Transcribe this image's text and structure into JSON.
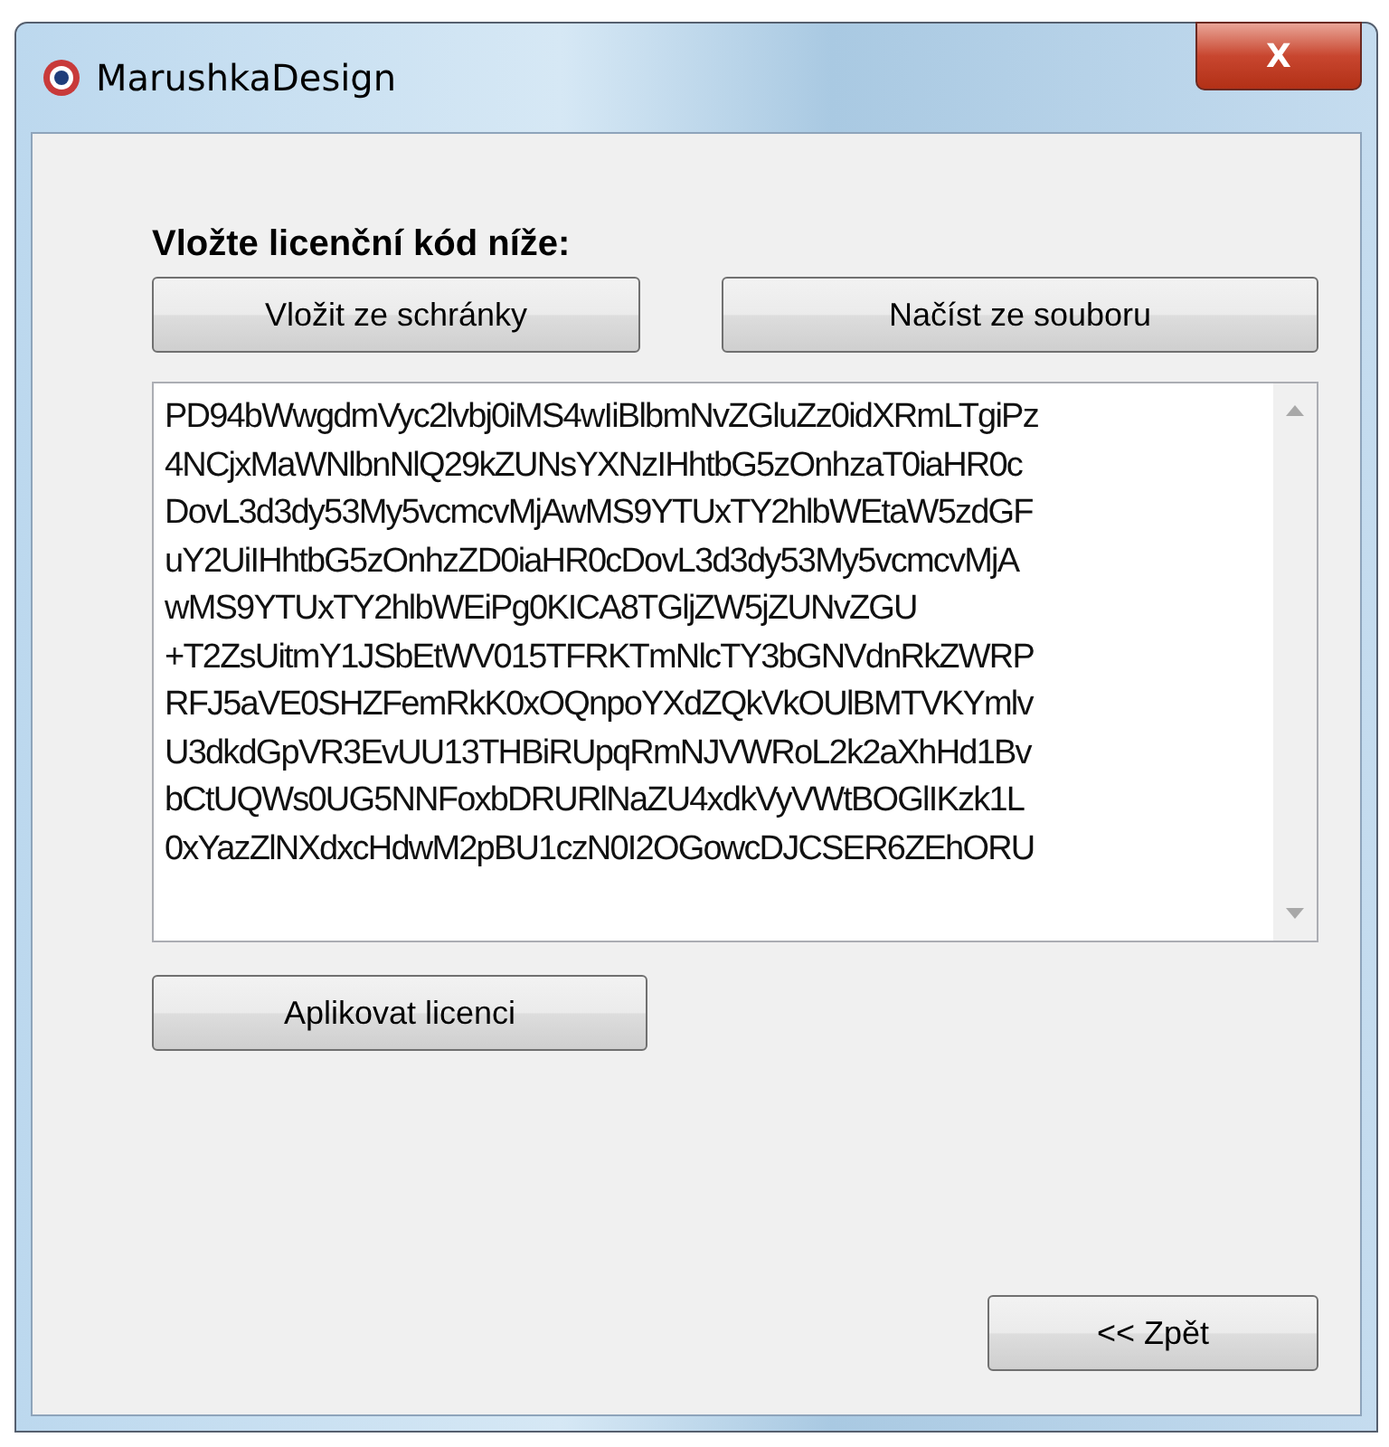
{
  "window": {
    "title": "MarushkaDesign",
    "close_label": "X"
  },
  "prompt": "Vložte licenční kód níže:",
  "buttons": [
    {
      "label": "Vložit ze schránky"
    },
    {
      "label": "Načíst ze souboru"
    }
  ],
  "license_code": [
    "PD94bWwgdmVyc2lvbj0iMS4wIiBlbmNvZGluZz0idXRmLTgiPz",
    "4NCjxMaWNlbnNlQ29kZUNsYXNzIHhtbG5zOnhzaT0iaHR0c",
    "DovL3d3dy53My5vcmcvMjAwMS9YTUxTY2hlbWEtaW5zdGF",
    "uY2UiIHhtbG5zOnhzZD0iaHR0cDovL3d3dy53My5vcmcvMjA",
    "wMS9YTUxTY2hlbWEiPg0KICA8TGljZW5jZUNvZGU",
    "+T2ZsUitmY1JSbEtWV015TFRKTmNlcTY3bGNVdnRkZWRP",
    "RFJ5aVE0SHZFemRkK0xOQnpoYXdZQkVkOUlBMTVKYmlv",
    "U3dkdGpVR3EvUU13THBiRUpqRmNJVWRoL2k2aXhHd1Bv",
    "bCtUQWs0UG5NNFoxbDRURlNaZU4xdkVyVWtBOGlIKzk1L",
    "0xYazZlNXdxcHdwM2pBU1czN0I2OGowcDJCSER6ZEhORU"
  ],
  "apply_button": "Aplikovat licenci",
  "back_button": "<< Zpět"
}
